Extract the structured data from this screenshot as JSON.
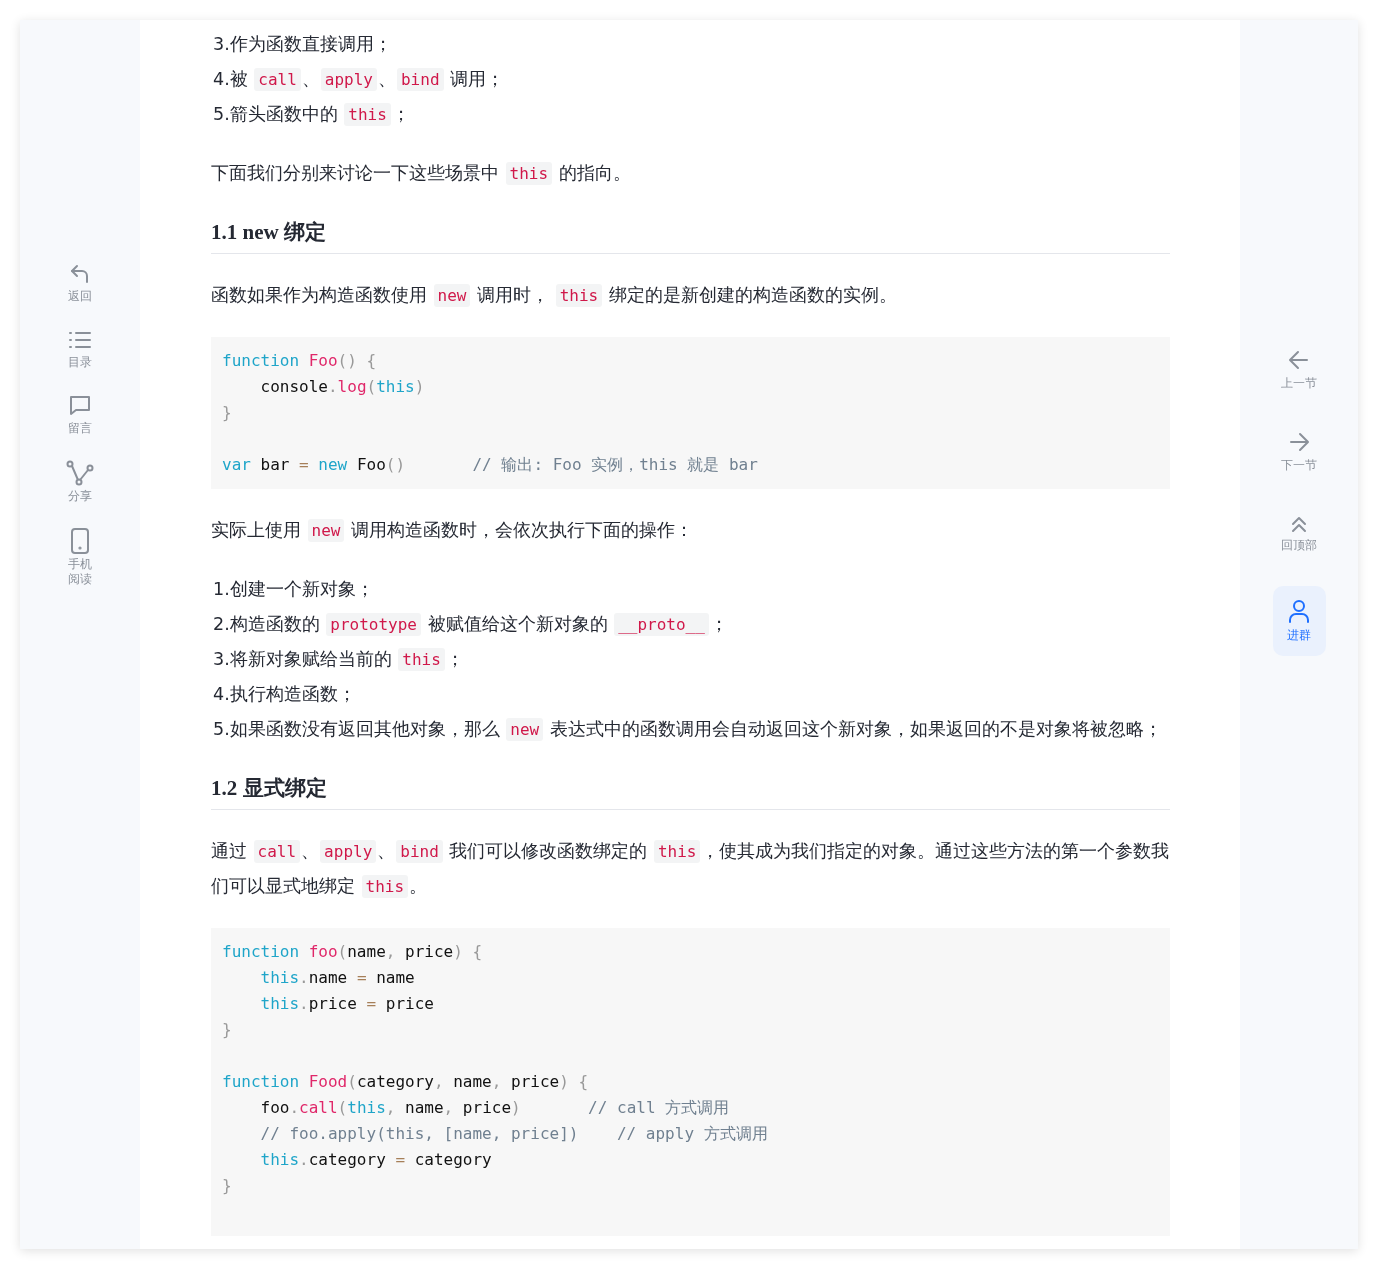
{
  "left_nav": [
    {
      "label": "返回"
    },
    {
      "label": "目录"
    },
    {
      "label": "留言"
    },
    {
      "label": "分享"
    },
    {
      "label": "手机阅读"
    }
  ],
  "right_nav": [
    {
      "label": "上一节",
      "selected": false
    },
    {
      "label": "下一节",
      "selected": false
    },
    {
      "label": "回顶部",
      "selected": false
    },
    {
      "label": "进群",
      "selected": true
    }
  ],
  "article": [
    {
      "kind": "list_item",
      "number": "3.",
      "segments": [
        {
          "kind": "text",
          "text": "作为函数直接调用；"
        }
      ]
    },
    {
      "kind": "list_item",
      "number": "4.",
      "segments": [
        {
          "kind": "text",
          "text": "被 "
        },
        {
          "kind": "code",
          "text": "call"
        },
        {
          "kind": "text",
          "text": "、"
        },
        {
          "kind": "code",
          "text": "apply"
        },
        {
          "kind": "text",
          "text": "、"
        },
        {
          "kind": "code",
          "text": "bind"
        },
        {
          "kind": "text",
          "text": " 调用；"
        }
      ]
    },
    {
      "kind": "list_item",
      "number": "5.",
      "segments": [
        {
          "kind": "text",
          "text": "箭头函数中的 "
        },
        {
          "kind": "code",
          "text": "this"
        },
        {
          "kind": "text",
          "text": "；"
        }
      ]
    },
    {
      "kind": "paragraph",
      "segments": [
        {
          "kind": "text",
          "text": "下面我们分别来讨论一下这些场景中 "
        },
        {
          "kind": "code",
          "text": "this"
        },
        {
          "kind": "text",
          "text": " 的指向。"
        }
      ]
    },
    {
      "kind": "heading",
      "text": "1.1 new 绑定"
    },
    {
      "kind": "paragraph",
      "segments": [
        {
          "kind": "text",
          "text": "函数如果作为构造函数使用 "
        },
        {
          "kind": "code",
          "text": "new"
        },
        {
          "kind": "text",
          "text": " 调用时， "
        },
        {
          "kind": "code",
          "text": "this"
        },
        {
          "kind": "text",
          "text": " 绑定的是新创建的构造函数的实例。"
        }
      ]
    },
    {
      "kind": "code_block",
      "lines": [
        {
          "kind": "code",
          "tokens": [
            {
              "kind": "kw",
              "text": "function"
            },
            {
              "kind": "fn",
              "text": " Foo"
            },
            {
              "kind": "p",
              "text": "() {"
            }
          ]
        },
        {
          "kind": "code",
          "tokens": [
            {
              "kind": "t",
              "text": "    console"
            },
            {
              "kind": "p",
              "text": "."
            },
            {
              "kind": "fn",
              "text": "log"
            },
            {
              "kind": "p",
              "text": "("
            },
            {
              "kind": "kw",
              "text": "this"
            },
            {
              "kind": "p",
              "text": ")"
            }
          ]
        },
        {
          "kind": "code",
          "tokens": [
            {
              "kind": "p",
              "text": "}"
            }
          ]
        },
        {
          "kind": "blank"
        },
        {
          "kind": "code",
          "tokens": [
            {
              "kind": "kw",
              "text": "var"
            },
            {
              "kind": "t",
              "text": " bar "
            },
            {
              "kind": "op",
              "text": "="
            },
            {
              "kind": "kw",
              "text": " new"
            },
            {
              "kind": "t",
              "text": " Foo"
            },
            {
              "kind": "p",
              "text": "()"
            },
            {
              "kind": "c",
              "text": "       // 输出: Foo 实例，this 就是 bar"
            }
          ]
        }
      ]
    },
    {
      "kind": "paragraph",
      "segments": [
        {
          "kind": "text",
          "text": "实际上使用 "
        },
        {
          "kind": "code",
          "text": "new"
        },
        {
          "kind": "text",
          "text": " 调用构造函数时，会依次执行下面的操作："
        }
      ]
    },
    {
      "kind": "list_item",
      "number": "1.",
      "segments": [
        {
          "kind": "text",
          "text": "创建一个新对象；"
        }
      ]
    },
    {
      "kind": "list_item",
      "number": "2.",
      "segments": [
        {
          "kind": "text",
          "text": "构造函数的 "
        },
        {
          "kind": "code",
          "text": "prototype"
        },
        {
          "kind": "text",
          "text": " 被赋值给这个新对象的 "
        },
        {
          "kind": "code",
          "text": "__proto__"
        },
        {
          "kind": "text",
          "text": "；"
        }
      ]
    },
    {
      "kind": "list_item",
      "number": "3.",
      "segments": [
        {
          "kind": "text",
          "text": "将新对象赋给当前的 "
        },
        {
          "kind": "code",
          "text": "this"
        },
        {
          "kind": "text",
          "text": "；"
        }
      ]
    },
    {
      "kind": "list_item",
      "number": "4.",
      "segments": [
        {
          "kind": "text",
          "text": "执行构造函数；"
        }
      ]
    },
    {
      "kind": "list_item",
      "number": "5.",
      "segments": [
        {
          "kind": "text",
          "text": "如果函数没有返回其他对象，那么 "
        },
        {
          "kind": "code",
          "text": "new"
        },
        {
          "kind": "text",
          "text": " 表达式中的函数调用会自动返回这个新对象，如果返回的不是对象将被忽略；"
        }
      ]
    },
    {
      "kind": "heading",
      "text": "1.2 显式绑定"
    },
    {
      "kind": "paragraph",
      "segments": [
        {
          "kind": "text",
          "text": "通过 "
        },
        {
          "kind": "code",
          "text": "call"
        },
        {
          "kind": "text",
          "text": "、"
        },
        {
          "kind": "code",
          "text": "apply"
        },
        {
          "kind": "text",
          "text": "、"
        },
        {
          "kind": "code",
          "text": "bind"
        },
        {
          "kind": "text",
          "text": " 我们可以修改函数绑定的 "
        },
        {
          "kind": "code",
          "text": "this"
        },
        {
          "kind": "text",
          "text": "，使其成为我们指定的对象。通过这些方法的第一个参数我们可以显式地绑定 "
        },
        {
          "kind": "code",
          "text": "this"
        },
        {
          "kind": "text",
          "text": "。"
        }
      ]
    },
    {
      "kind": "code_block",
      "lines": [
        {
          "kind": "code",
          "tokens": [
            {
              "kind": "kw",
              "text": "function"
            },
            {
              "kind": "fn",
              "text": " foo"
            },
            {
              "kind": "p",
              "text": "("
            },
            {
              "kind": "t",
              "text": "name"
            },
            {
              "kind": "p",
              "text": ","
            },
            {
              "kind": "t",
              "text": " price"
            },
            {
              "kind": "p",
              "text": ") {"
            }
          ]
        },
        {
          "kind": "code",
          "tokens": [
            {
              "kind": "kw",
              "text": "    this"
            },
            {
              "kind": "p",
              "text": "."
            },
            {
              "kind": "t",
              "text": "name "
            },
            {
              "kind": "op",
              "text": "="
            },
            {
              "kind": "t",
              "text": " name"
            }
          ]
        },
        {
          "kind": "code",
          "tokens": [
            {
              "kind": "kw",
              "text": "    this"
            },
            {
              "kind": "p",
              "text": "."
            },
            {
              "kind": "t",
              "text": "price "
            },
            {
              "kind": "op",
              "text": "="
            },
            {
              "kind": "t",
              "text": " price"
            }
          ]
        },
        {
          "kind": "code",
          "tokens": [
            {
              "kind": "p",
              "text": "}"
            }
          ]
        },
        {
          "kind": "blank"
        },
        {
          "kind": "code",
          "tokens": [
            {
              "kind": "kw",
              "text": "function"
            },
            {
              "kind": "fn",
              "text": " Food"
            },
            {
              "kind": "p",
              "text": "("
            },
            {
              "kind": "t",
              "text": "category"
            },
            {
              "kind": "p",
              "text": ","
            },
            {
              "kind": "t",
              "text": " name"
            },
            {
              "kind": "p",
              "text": ","
            },
            {
              "kind": "t",
              "text": " price"
            },
            {
              "kind": "p",
              "text": ") {"
            }
          ]
        },
        {
          "kind": "code",
          "tokens": [
            {
              "kind": "t",
              "text": "    foo"
            },
            {
              "kind": "p",
              "text": "."
            },
            {
              "kind": "fn",
              "text": "call"
            },
            {
              "kind": "p",
              "text": "("
            },
            {
              "kind": "kw",
              "text": "this"
            },
            {
              "kind": "p",
              "text": ","
            },
            {
              "kind": "t",
              "text": " name"
            },
            {
              "kind": "p",
              "text": ","
            },
            {
              "kind": "t",
              "text": " price"
            },
            {
              "kind": "p",
              "text": ")"
            },
            {
              "kind": "c",
              "text": "       // call 方式调用"
            }
          ]
        },
        {
          "kind": "code",
          "tokens": [
            {
              "kind": "c",
              "text": "    // foo.apply(this, [name, price])    // apply 方式调用"
            }
          ]
        },
        {
          "kind": "code",
          "tokens": [
            {
              "kind": "kw",
              "text": "    this"
            },
            {
              "kind": "p",
              "text": "."
            },
            {
              "kind": "t",
              "text": "category "
            },
            {
              "kind": "op",
              "text": "="
            },
            {
              "kind": "t",
              "text": " category"
            }
          ]
        },
        {
          "kind": "code",
          "tokens": [
            {
              "kind": "p",
              "text": "}"
            }
          ]
        },
        {
          "kind": "blank"
        }
      ]
    }
  ]
}
